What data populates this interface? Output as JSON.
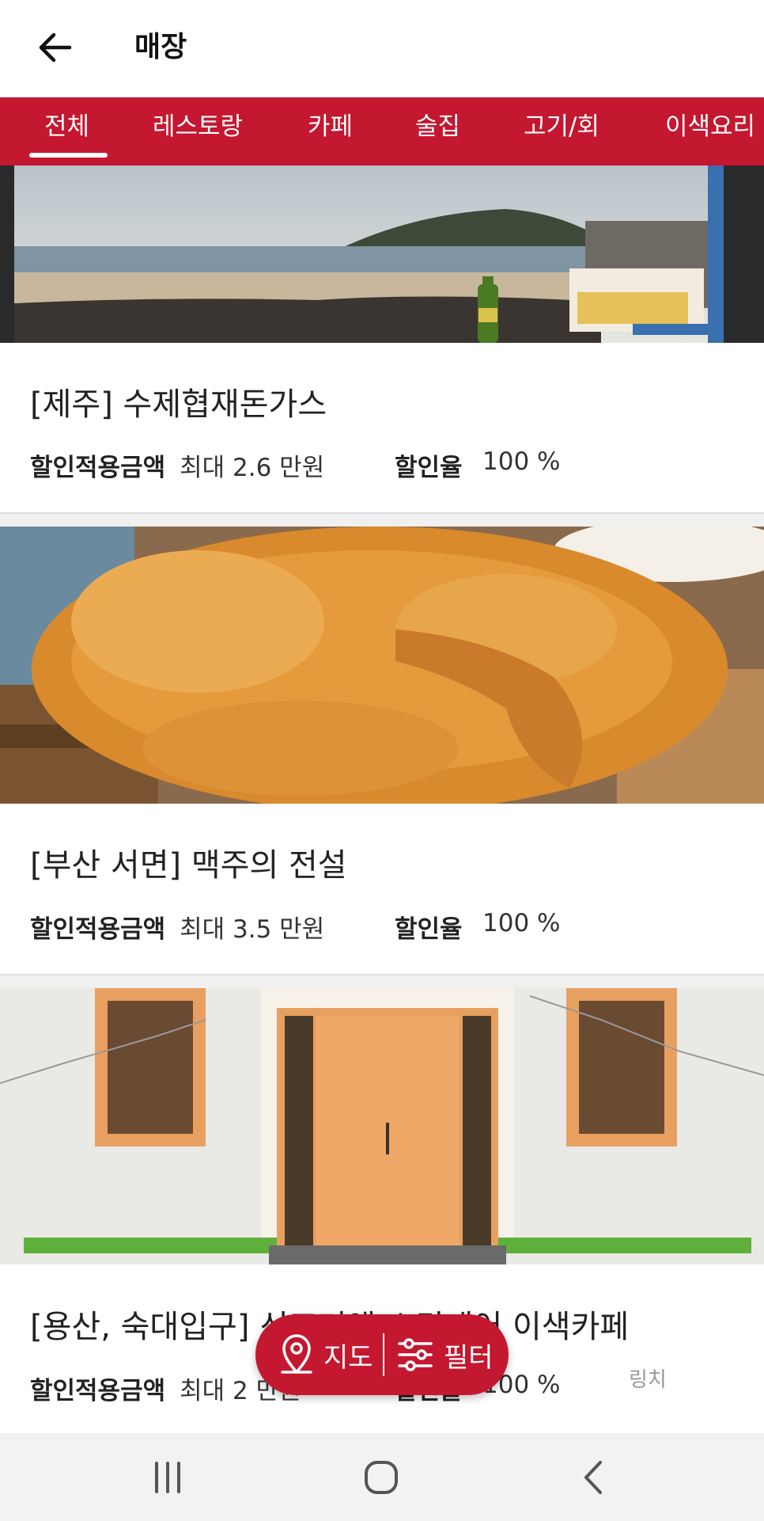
{
  "header": {
    "title": "매장"
  },
  "tabs": [
    {
      "label": "전체"
    },
    {
      "label": "레스토랑"
    },
    {
      "label": "카페"
    },
    {
      "label": "술집"
    },
    {
      "label": "고기/회"
    },
    {
      "label": "이색요리"
    }
  ],
  "stores": [
    {
      "title": "[제주] 수제협재돈가스",
      "discount_amount_label": "할인적용금액",
      "discount_amount": "최대 2.6 만원",
      "rate_label": "할인율",
      "rate": "100 %"
    },
    {
      "title": "[부산 서면] 맥주의 전설",
      "discount_amount_label": "할인적용금액",
      "discount_amount": "최대 3.5 만원",
      "rate_label": "할인율",
      "rate": "100 %"
    },
    {
      "title": "[용산, 숙대입구] 신포커앤 스킨케어 이색카페",
      "discount_amount_label": "할인적용금액",
      "discount_amount": "최대 2 만원",
      "rate_label": "할인율",
      "rate": "100 %"
    }
  ],
  "fab": {
    "map_label": "지도",
    "filter_label": "필터"
  },
  "watermark": "링치",
  "colors": {
    "brand": "#c41730"
  }
}
